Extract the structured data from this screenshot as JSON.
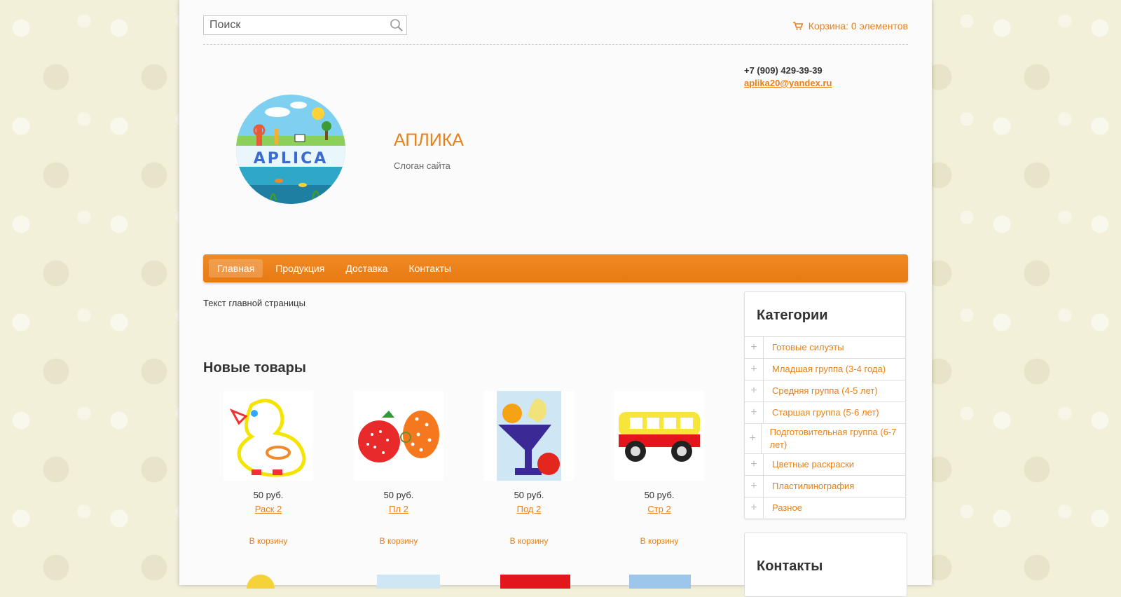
{
  "search": {
    "placeholder": "Поиск"
  },
  "cart": {
    "label": "Корзина: 0 элементов"
  },
  "contacts_top": {
    "phone": "+7 (909) 429-39-39",
    "email": "aplika20@yandex.ru"
  },
  "site": {
    "title": "АПЛИКА",
    "slogan": "Слоган сайта",
    "logo_text": "APLICA"
  },
  "nav": {
    "items": [
      "Главная",
      "Продукция",
      "Доставка",
      "Контакты"
    ],
    "active": "Главная"
  },
  "main": {
    "text": "Текст главной страницы",
    "new_products_title": "Новые товары"
  },
  "products": [
    {
      "price": "50 руб.",
      "name": "Раск 2",
      "buy": "В корзину"
    },
    {
      "price": "50 руб.",
      "name": "Пл 2",
      "buy": "В корзину"
    },
    {
      "price": "50 руб.",
      "name": "Под 2",
      "buy": "В корзину"
    },
    {
      "price": "50 руб.",
      "name": "Стр 2",
      "buy": "В корзину"
    }
  ],
  "sidebar": {
    "categories_title": "Категории",
    "categories": [
      "Готовые силуэты",
      "Младшая группа (3-4 года)",
      "Средняя группа (4-5 лет)",
      "Старшая группа (5-6 лет)",
      "Подготовительная группа (6-7 лет)",
      "Цветные раскраски",
      "Пластилинография",
      "Разное"
    ],
    "contacts_title": "Контакты"
  },
  "colors": {
    "accent": "#e8801a",
    "nav": "#ee8420"
  }
}
